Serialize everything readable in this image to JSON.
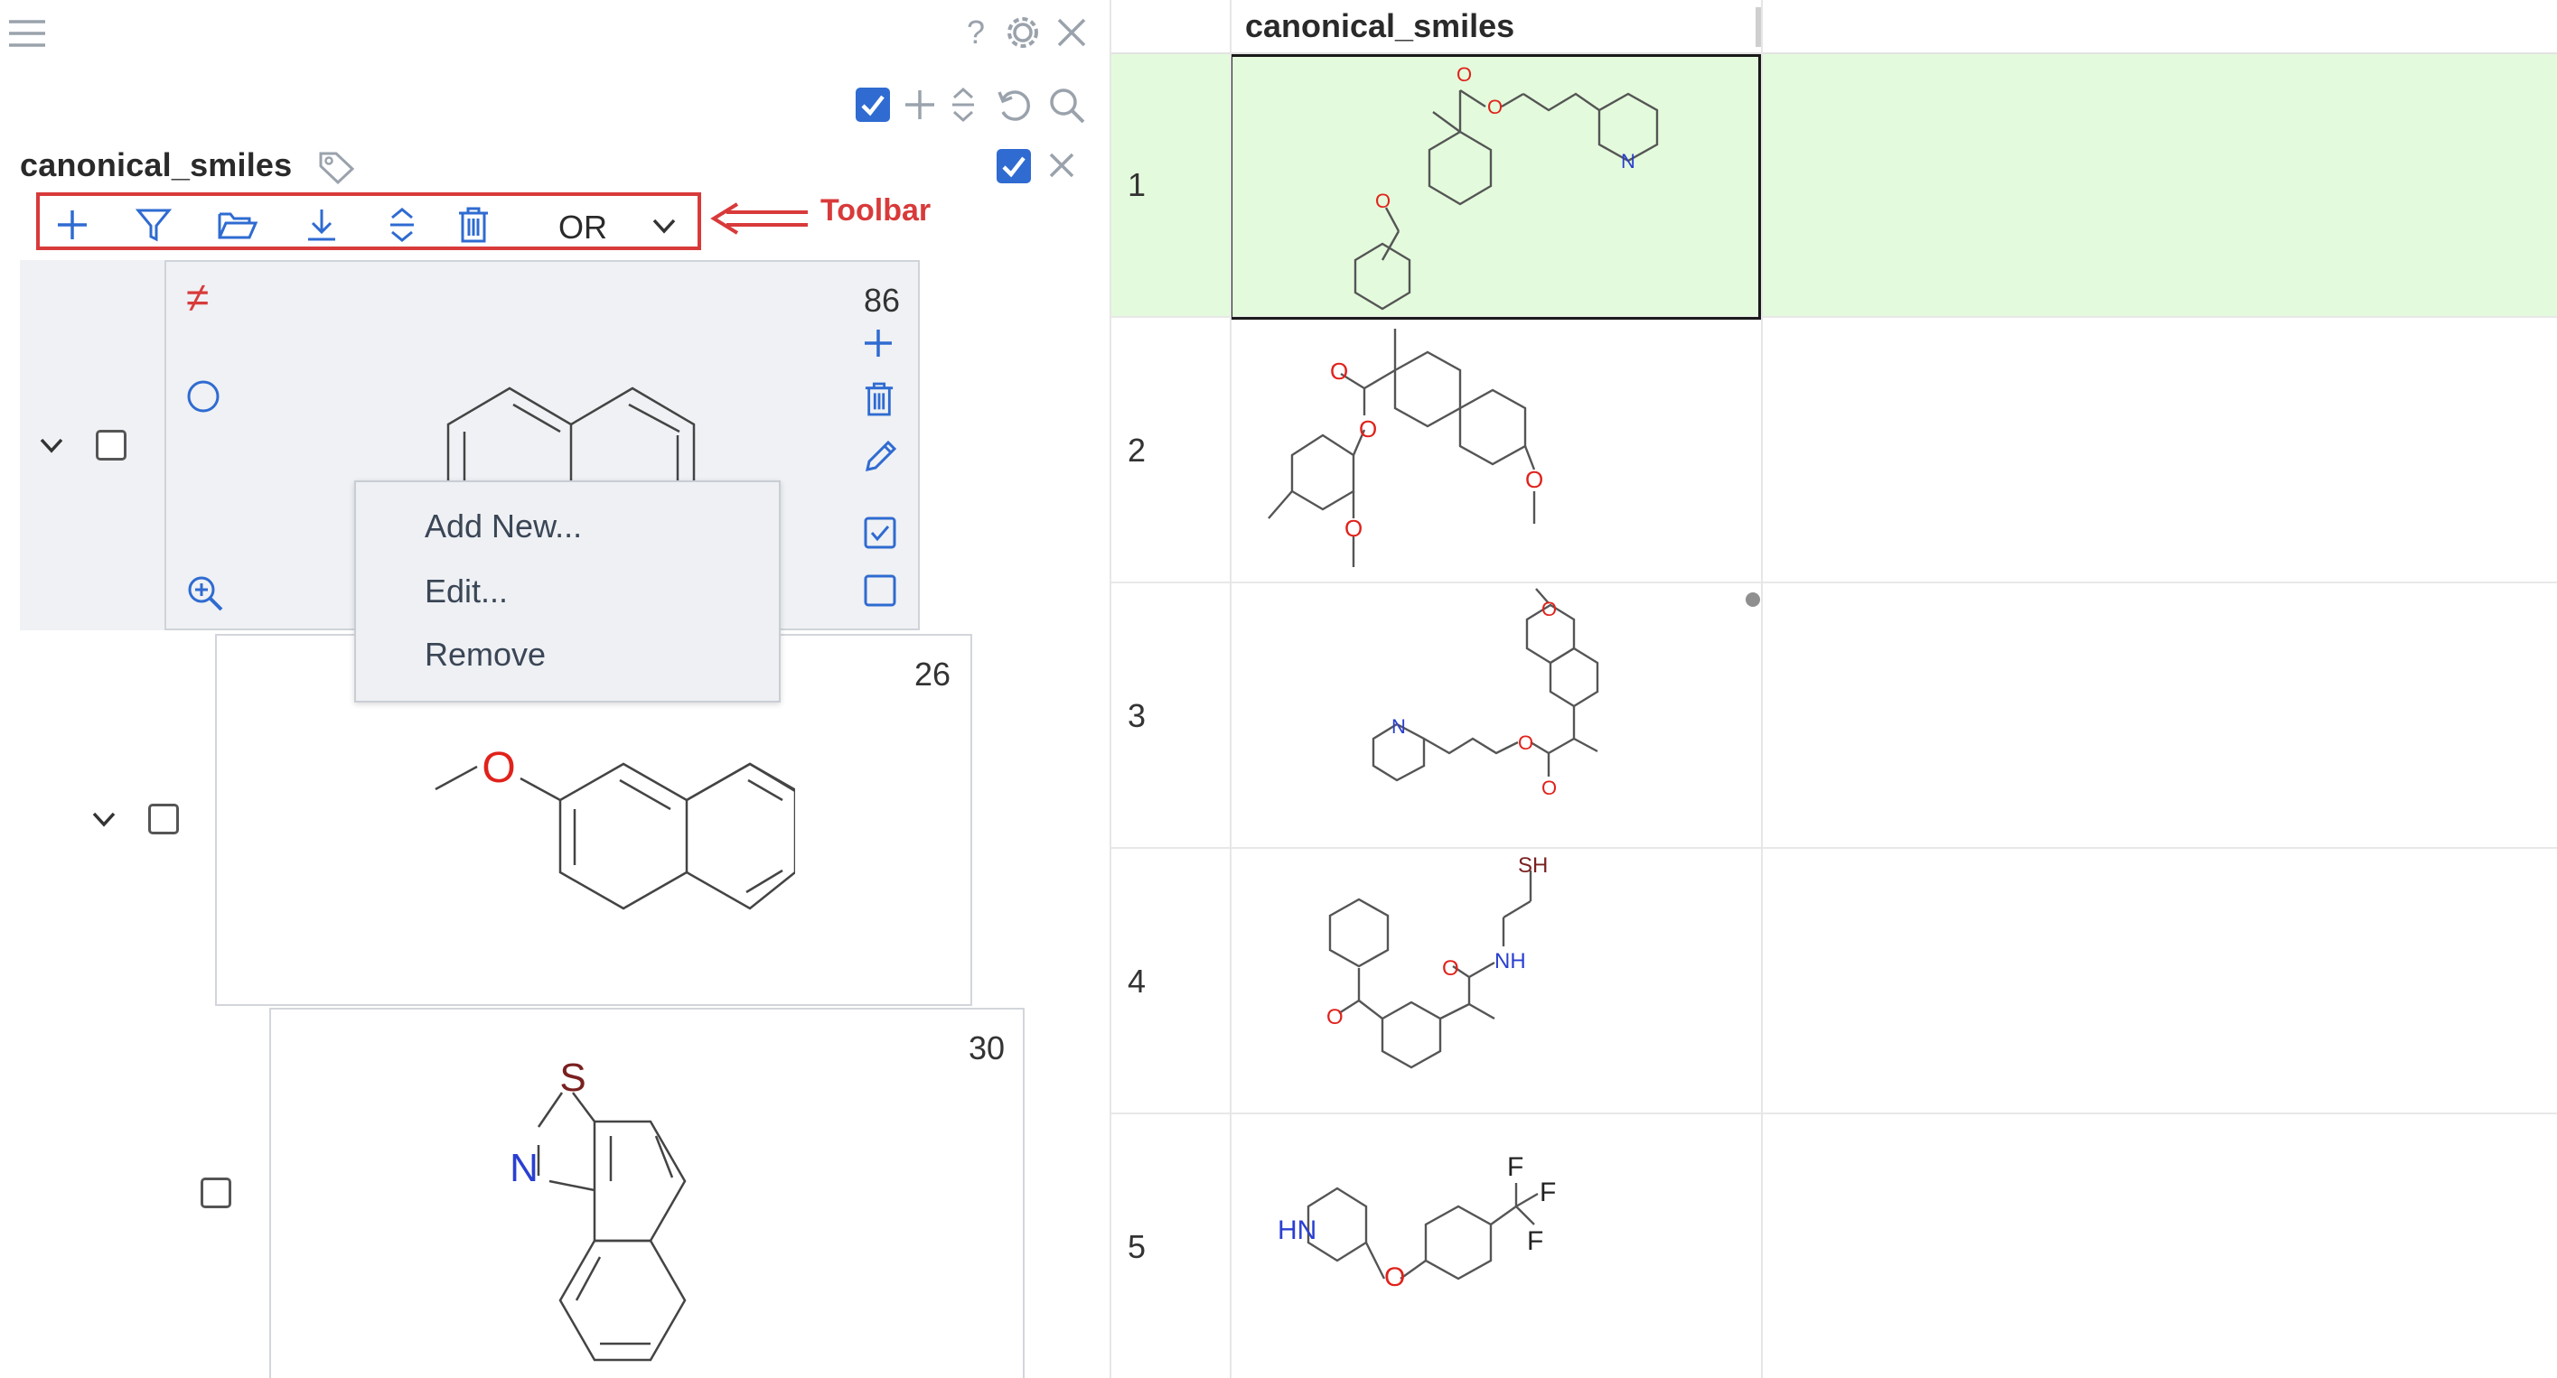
{
  "panel": {
    "menu_icon": "hamburger-icon",
    "top_icons": [
      "help-icon",
      "settings-icon",
      "close-icon"
    ],
    "second_row_icons": [
      "checkbox-checked-icon",
      "plus-icon",
      "expand-collapse-icon",
      "undo-icon",
      "search-icon"
    ],
    "column": {
      "name": "canonical_smiles",
      "tag_icon": "tag-icon"
    }
  },
  "toolbar": {
    "icons": [
      "plus-icon",
      "filter-icon",
      "folder-open-icon",
      "download-icon",
      "expand-collapse-icon",
      "trash-icon"
    ],
    "mode": "OR",
    "annotation": "Toolbar",
    "accent": "#d83a3a"
  },
  "tree": {
    "nodes": [
      {
        "count": "86",
        "not_symbol": "≠",
        "checked": false,
        "expanded": true
      },
      {
        "count": "26",
        "heteroatom": "O",
        "checked": false,
        "expanded": true
      },
      {
        "count": "30",
        "heteroatoms": [
          "S",
          "N"
        ],
        "checked": false,
        "expanded": false
      }
    ]
  },
  "context_menu": {
    "items": [
      {
        "label": "Add New..."
      },
      {
        "label": "Edit..."
      },
      {
        "label": "Remove"
      }
    ]
  },
  "grid": {
    "header": "canonical_smiles",
    "selected_row_color": "#e3fbdc",
    "rows": [
      {
        "num": "1",
        "atoms": [
          "O",
          "O",
          "O",
          "N"
        ]
      },
      {
        "num": "2",
        "atoms": [
          "O",
          "O",
          "O",
          "O"
        ]
      },
      {
        "num": "3",
        "atoms": [
          "O",
          "N",
          "O",
          "O"
        ]
      },
      {
        "num": "4",
        "atoms": [
          "SH",
          "O",
          "NH",
          "O"
        ]
      },
      {
        "num": "5",
        "atoms": [
          "F",
          "F",
          "F",
          "HN",
          "O"
        ]
      }
    ]
  },
  "colors": {
    "accent_blue": "#2f6bd1",
    "oxygen": "#e0221b",
    "nitrogen": "#2a3fd1",
    "sulfur": "#7a2020"
  }
}
